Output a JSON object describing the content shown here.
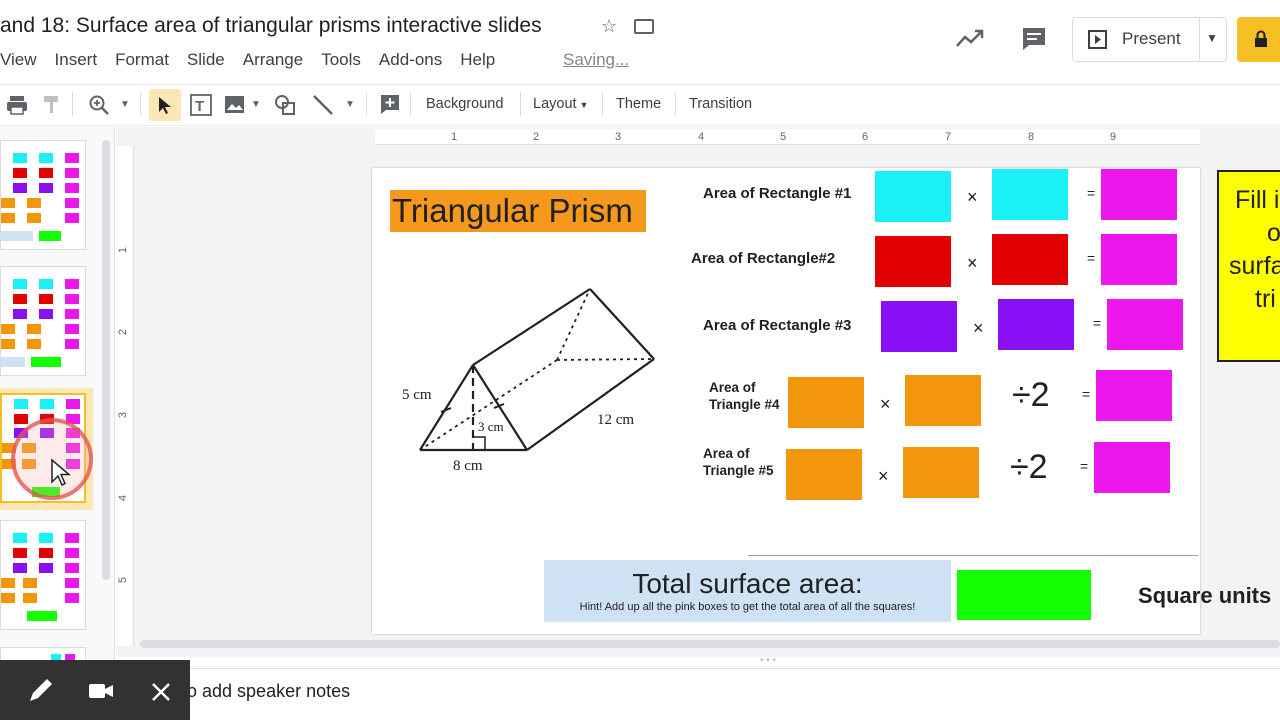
{
  "title": "and 18: Surface area of triangular prisms interactive slides",
  "menu": [
    "View",
    "Insert",
    "Format",
    "Slide",
    "Arrange",
    "Tools",
    "Add-ons",
    "Help"
  ],
  "saving": "Saving...",
  "present_label": "Present",
  "toolbar": {
    "background": "Background",
    "layout": "Layout",
    "theme": "Theme",
    "transition": "Transition"
  },
  "ruler_top": [
    "1",
    "2",
    "3",
    "4",
    "5",
    "6",
    "7",
    "8",
    "9"
  ],
  "ruler_left": [
    "1",
    "2",
    "3",
    "4",
    "5"
  ],
  "slide": {
    "title": "Triangular Prism",
    "diagram": {
      "d5": "5 cm",
      "d3": "3 cm",
      "d8": "8 cm",
      "d12": "12 cm"
    },
    "rows": [
      {
        "label": "Area of Rectangle #1",
        "op": "×",
        "eq": "="
      },
      {
        "label": "Area of Rectangle#2",
        "op": "×",
        "eq": "="
      },
      {
        "label": "Area of Rectangle #3",
        "op": "×",
        "eq": "="
      }
    ],
    "tri4": {
      "line1": "Area of",
      "line2": "Triangle #4",
      "op": "×",
      "div": "÷2",
      "eq": "="
    },
    "tri5": {
      "line1": "Area of",
      "line2": "Triangle #5",
      "op": "×",
      "div": "÷2",
      "eq": "="
    },
    "total_label": "Total surface area:",
    "total_hint": "Hint! Add up all the pink boxes to get the total area of all the squares!",
    "square_units": "Square units",
    "instruction": [
      "Fill i",
      "o",
      "surfa",
      "tri"
    ]
  },
  "notes": "o add speaker notes",
  "colors": {
    "cyan": "#1af0f7",
    "red": "#e30000",
    "magenta": "#ec17ec",
    "purple": "#8a0ff5",
    "orange": "#f2960c",
    "green": "#11ff00",
    "present_yellow": "#f6bf26"
  }
}
